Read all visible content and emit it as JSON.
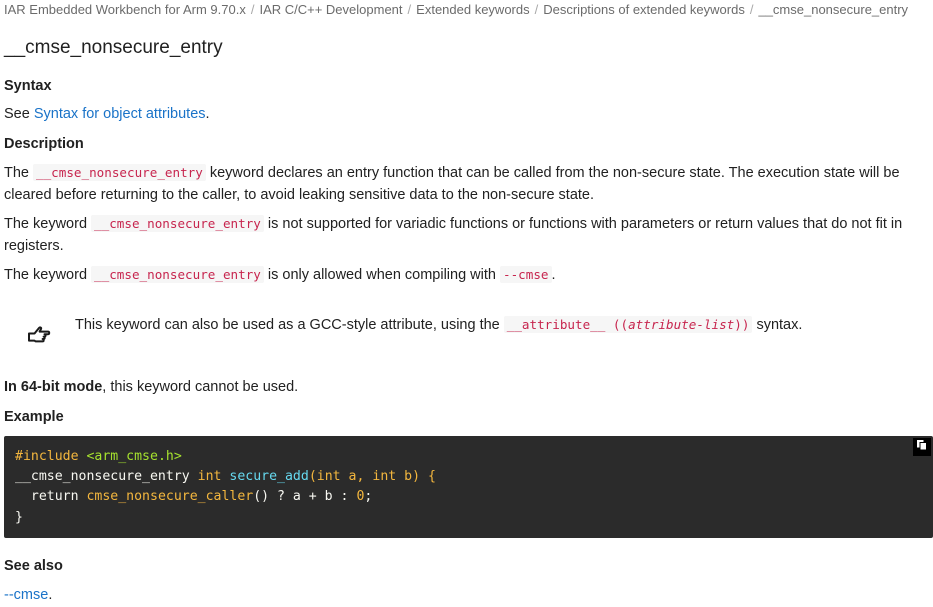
{
  "breadcrumb": [
    "IAR Embedded Workbench for Arm 9.70.x",
    "IAR C/C++ Development",
    "Extended keywords",
    "Descriptions of extended keywords",
    "__cmse_nonsecure_entry"
  ],
  "page": {
    "title": "__cmse_nonsecure_entry"
  },
  "syntax": {
    "heading": "Syntax",
    "prefix": "See ",
    "link": "Syntax for object attributes",
    "suffix": "."
  },
  "description": {
    "heading": "Description",
    "p1": {
      "pre": "The ",
      "code": "__cmse_nonsecure_entry",
      "post": " keyword declares an entry function that can be called from the non-secure state. The execution state will be cleared before returning to the caller, to avoid leaking sensitive data to the non-secure state."
    },
    "p2": {
      "pre": "The keyword ",
      "code": "__cmse_nonsecure_entry",
      "post": " is not supported for variadic functions or functions with parameters or return values that do not fit in registers."
    },
    "p3": {
      "pre": "The keyword ",
      "code": "__cmse_nonsecure_entry",
      "mid": " is only allowed when compiling with ",
      "code2": "--cmse",
      "post": "."
    }
  },
  "note": {
    "icon": "pointing-hand-icon",
    "pre": "This keyword can also be used as a GCC-style attribute, using the ",
    "code_a": "__attribute__ ((",
    "code_italic": "attribute-list",
    "code_b": "))",
    "post": " syntax."
  },
  "mode": {
    "bold": "In 64-bit mode",
    "text": ", this keyword cannot be used."
  },
  "example": {
    "heading": "Example",
    "copy_icon": "copy-icon",
    "line1": {
      "pp": "#include",
      "inc": "<arm_cmse.h>"
    },
    "line2": {
      "kw": "__cmse_nonsecure_entry",
      "type1": "int",
      "fn": "secure_add",
      "open": "(",
      "type2": "int",
      "a": "a,",
      "type3": "int",
      "b": "b) {"
    },
    "line3": {
      "ret": "return",
      "call": "cmse_nonsecure_caller",
      "rest": "() ? a + b :",
      "num": "0",
      "semi": ";"
    },
    "line4": "}"
  },
  "see_also": {
    "heading": "See also",
    "link": "--cmse",
    "suffix": "."
  },
  "colors": {
    "link": "#1a73c8",
    "inline_code": "#c7254e",
    "code_bg": "#2b2b2b"
  }
}
